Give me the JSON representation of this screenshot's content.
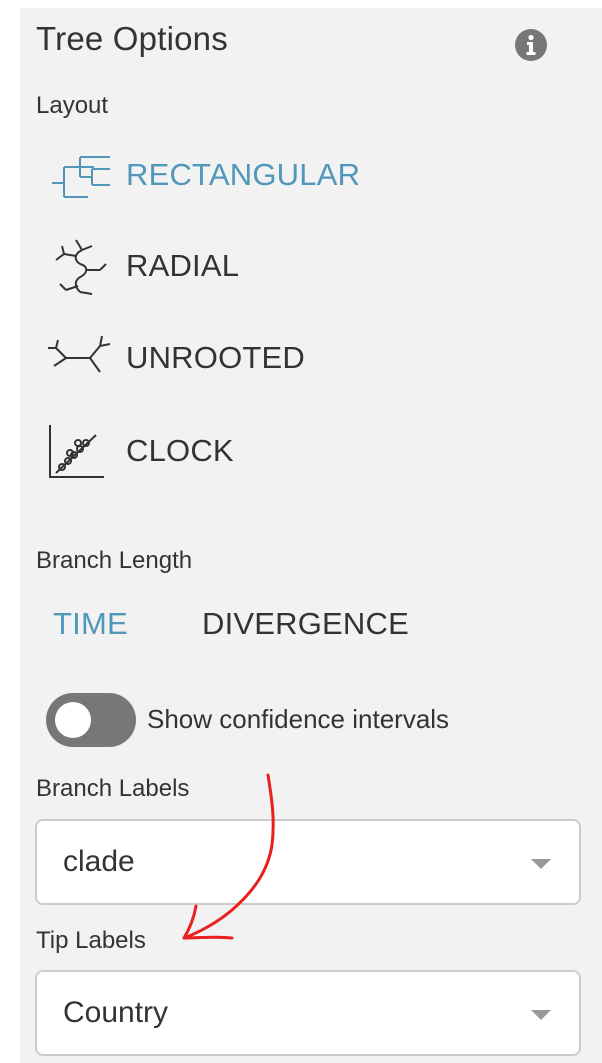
{
  "panel": {
    "title": "Tree Options",
    "info_icon": "info-circle-icon"
  },
  "layout": {
    "label": "Layout",
    "options": [
      {
        "label": "RECTANGULAR",
        "icon": "rectangular-tree-icon",
        "selected": true
      },
      {
        "label": "RADIAL",
        "icon": "radial-tree-icon",
        "selected": false
      },
      {
        "label": "UNROOTED",
        "icon": "unrooted-tree-icon",
        "selected": false
      },
      {
        "label": "CLOCK",
        "icon": "clock-tree-icon",
        "selected": false
      }
    ]
  },
  "branch_length": {
    "label": "Branch Length",
    "options": [
      "TIME",
      "DIVERGENCE"
    ],
    "selected": "TIME"
  },
  "confidence": {
    "label": "Show confidence intervals",
    "enabled": false
  },
  "branch_labels": {
    "label": "Branch Labels",
    "value": "clade"
  },
  "tip_labels": {
    "label": "Tip Labels",
    "value": "Country"
  },
  "colors": {
    "accent": "#5097ba",
    "text": "#333333",
    "panel_bg": "#f2f2f2",
    "toggle_off": "#777777",
    "annotation": "#e8201f"
  }
}
